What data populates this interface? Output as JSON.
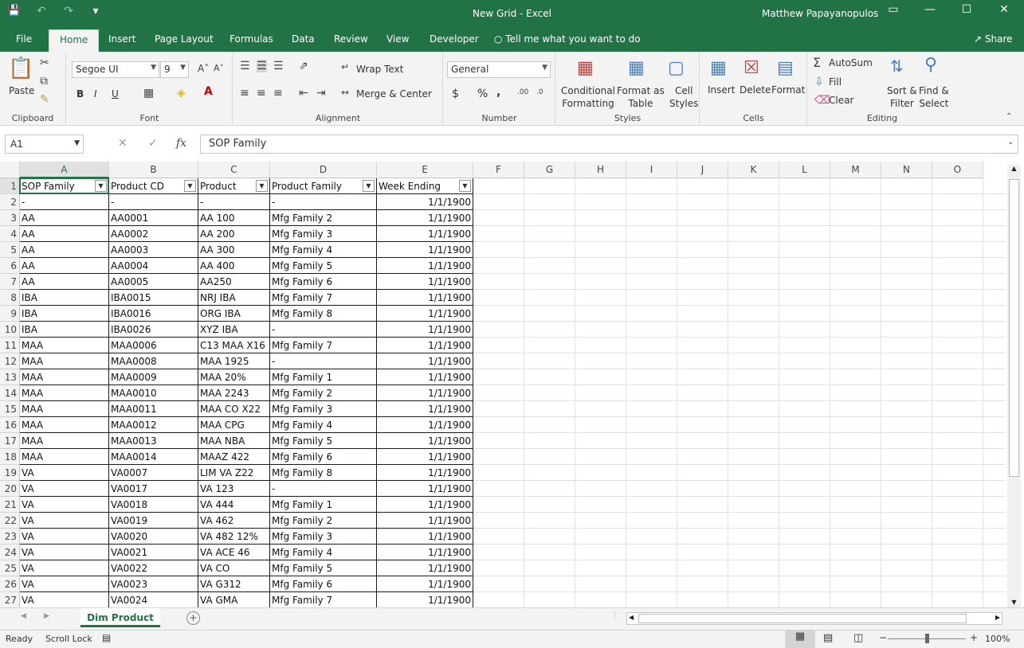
{
  "window": {
    "title": "New Grid  -  Excel",
    "user": "Matthew Papayanopulos",
    "controls": {
      "restore_icon": "▭",
      "minimize": "—",
      "maximize": "☐",
      "close": "✕"
    }
  },
  "qat": {
    "save": "💾",
    "undo": "↶",
    "redo": "↷",
    "customize": "▾"
  },
  "tabs": [
    "File",
    "Home",
    "Insert",
    "Page Layout",
    "Formulas",
    "Data",
    "Review",
    "View",
    "Developer"
  ],
  "tell_me": "Tell me what you want to do",
  "share": "Share",
  "ribbon": {
    "clipboard": {
      "label": "Clipboard",
      "paste": "Paste"
    },
    "font": {
      "label": "Font",
      "name": "Segoe UI",
      "size": "9",
      "bold": "B",
      "italic": "I",
      "underline": "U"
    },
    "alignment": {
      "label": "Alignment",
      "wrap": "Wrap Text",
      "merge": "Merge & Center"
    },
    "number": {
      "label": "Number",
      "format": "General",
      "currency": "$",
      "percent": "%",
      "comma": ","
    },
    "styles": {
      "label": "Styles",
      "conditional": "Conditional\nFormatting",
      "format_table": "Format as\nTable",
      "cell_styles": "Cell\nStyles"
    },
    "cells": {
      "label": "Cells",
      "insert": "Insert",
      "delete": "Delete",
      "format": "Format"
    },
    "editing": {
      "label": "Editing",
      "autosum": "AutoSum",
      "fill": "Fill",
      "clear": "Clear",
      "sort": "Sort &\nFilter",
      "find": "Find &\nSelect"
    }
  },
  "formula_bar": {
    "name_box": "A1",
    "fx": "fx",
    "content": "SOP Family"
  },
  "columns": [
    "A",
    "B",
    "C",
    "D",
    "E",
    "F",
    "G",
    "H",
    "I",
    "J",
    "K",
    "L",
    "M",
    "N",
    "O"
  ],
  "headers": [
    "SOP Family",
    "Product CD",
    "Product",
    "Product Family",
    "Week Ending"
  ],
  "rows": [
    [
      "-",
      "-",
      "-",
      "-",
      "1/1/1900"
    ],
    [
      "AA",
      "AA0001",
      "AA 100",
      "Mfg Family 2",
      "1/1/1900"
    ],
    [
      "AA",
      "AA0002",
      "AA 200",
      "Mfg Family 3",
      "1/1/1900"
    ],
    [
      "AA",
      "AA0003",
      "AA 300",
      "Mfg Family 4",
      "1/1/1900"
    ],
    [
      "AA",
      "AA0004",
      "AA 400",
      "Mfg Family 5",
      "1/1/1900"
    ],
    [
      "AA",
      "AA0005",
      "AA250",
      "Mfg Family 6",
      "1/1/1900"
    ],
    [
      "IBA",
      "IBA0015",
      "NRJ IBA",
      "Mfg Family 7",
      "1/1/1900"
    ],
    [
      "IBA",
      "IBA0016",
      "ORG IBA",
      "Mfg Family 8",
      "1/1/1900"
    ],
    [
      "IBA",
      "IBA0026",
      "XYZ IBA",
      "-",
      "1/1/1900"
    ],
    [
      "MAA",
      "MAA0006",
      "C13 MAA X16",
      "Mfg Family 7",
      "1/1/1900"
    ],
    [
      "MAA",
      "MAA0008",
      "MAA 1925",
      "-",
      "1/1/1900"
    ],
    [
      "MAA",
      "MAA0009",
      "MAA 20%",
      "Mfg Family 1",
      "1/1/1900"
    ],
    [
      "MAA",
      "MAA0010",
      "MAA 2243",
      "Mfg Family 2",
      "1/1/1900"
    ],
    [
      "MAA",
      "MAA0011",
      "MAA CO X22",
      "Mfg Family 3",
      "1/1/1900"
    ],
    [
      "MAA",
      "MAA0012",
      "MAA CPG",
      "Mfg Family 4",
      "1/1/1900"
    ],
    [
      "MAA",
      "MAA0013",
      "MAA NBA",
      "Mfg Family 5",
      "1/1/1900"
    ],
    [
      "MAA",
      "MAA0014",
      "MAAZ 422",
      "Mfg Family 6",
      "1/1/1900"
    ],
    [
      "VA",
      "VA0007",
      "LIM VA Z22",
      "Mfg Family 8",
      "1/1/1900"
    ],
    [
      "VA",
      "VA0017",
      "VA 123",
      "-",
      "1/1/1900"
    ],
    [
      "VA",
      "VA0018",
      "VA 444",
      "Mfg Family 1",
      "1/1/1900"
    ],
    [
      "VA",
      "VA0019",
      "VA 462",
      "Mfg Family 2",
      "1/1/1900"
    ],
    [
      "VA",
      "VA0020",
      "VA 482 12%",
      "Mfg Family 3",
      "1/1/1900"
    ],
    [
      "VA",
      "VA0021",
      "VA ACE 46",
      "Mfg Family 4",
      "1/1/1900"
    ],
    [
      "VA",
      "VA0022",
      "VA CO",
      "Mfg Family 5",
      "1/1/1900"
    ],
    [
      "VA",
      "VA0023",
      "VA G312",
      "Mfg Family 6",
      "1/1/1900"
    ],
    [
      "VA",
      "VA0024",
      "VA GMA",
      "Mfg Family 7",
      "1/1/1900"
    ]
  ],
  "sheet_tab": "Dim Product",
  "status": {
    "ready": "Ready",
    "scroll_lock": "Scroll Lock",
    "zoom": "100%"
  }
}
